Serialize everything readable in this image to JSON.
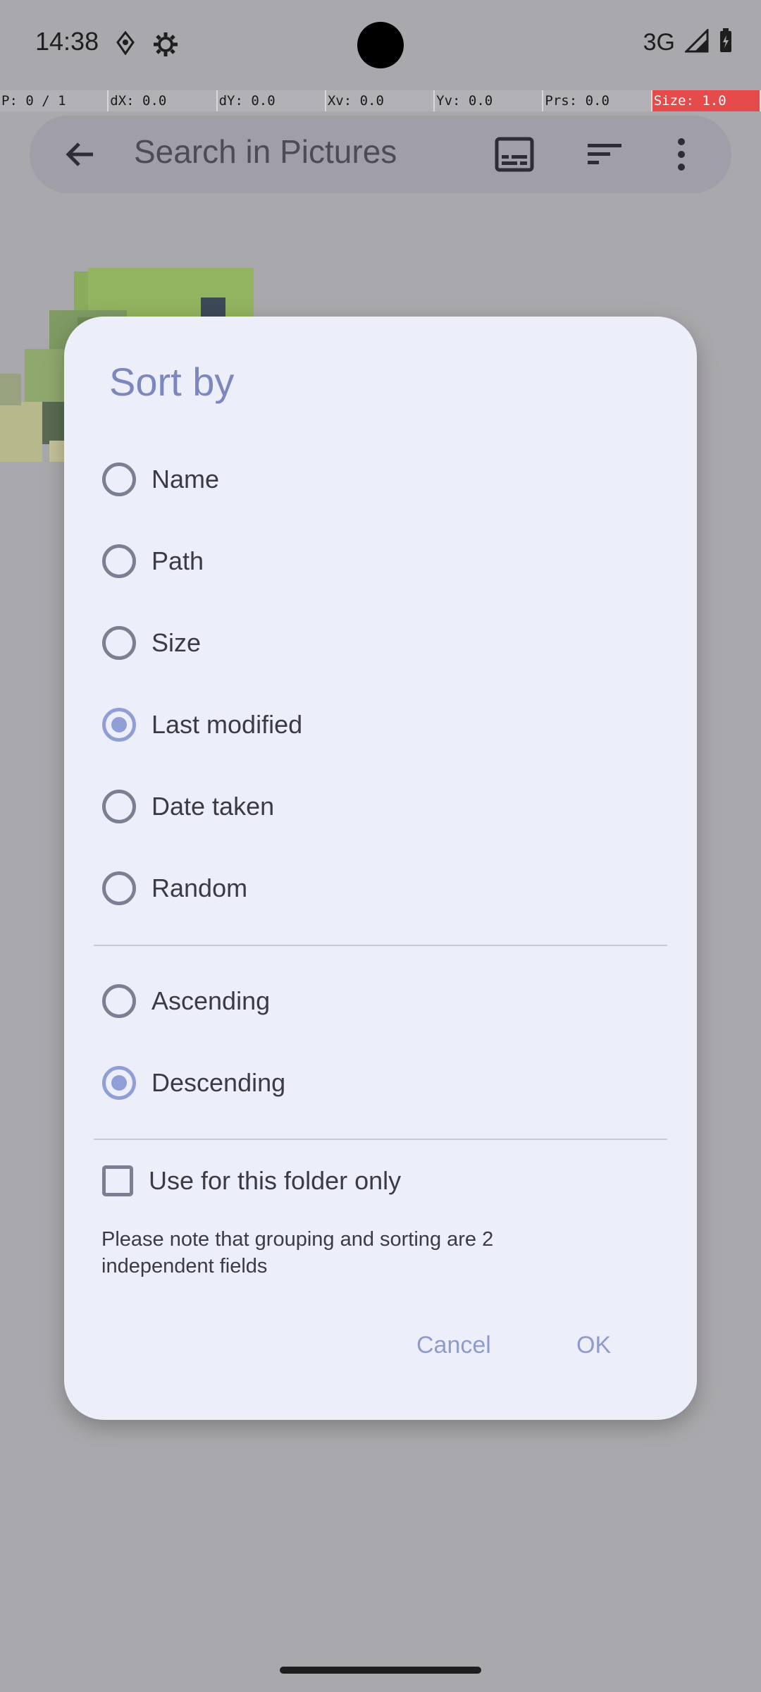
{
  "status_bar": {
    "time": "14:38",
    "network": "3G"
  },
  "debug_bar": [
    "P: 0 / 1",
    "dX: 0.0",
    "dY: 0.0",
    "Xv: 0.0",
    "Yv: 0.0",
    "Prs: 0.0",
    "Size: 1.0"
  ],
  "search": {
    "placeholder": "Search in Pictures"
  },
  "dialog": {
    "title": "Sort by",
    "sort_options": [
      {
        "label": "Name",
        "checked": false
      },
      {
        "label": "Path",
        "checked": false
      },
      {
        "label": "Size",
        "checked": false
      },
      {
        "label": "Last modified",
        "checked": true
      },
      {
        "label": "Date taken",
        "checked": false
      },
      {
        "label": "Random",
        "checked": false
      }
    ],
    "order_options": [
      {
        "label": "Ascending",
        "checked": false
      },
      {
        "label": "Descending",
        "checked": true
      }
    ],
    "folder_only": {
      "label": "Use for this folder only",
      "checked": false
    },
    "note": "Please note that grouping and sorting are 2 independent fields",
    "cancel_label": "Cancel",
    "ok_label": "OK"
  },
  "colors": {
    "accent": "#8f9fd6",
    "dialog_bg": "#eceefa",
    "scrim": "#a9a8ac"
  }
}
